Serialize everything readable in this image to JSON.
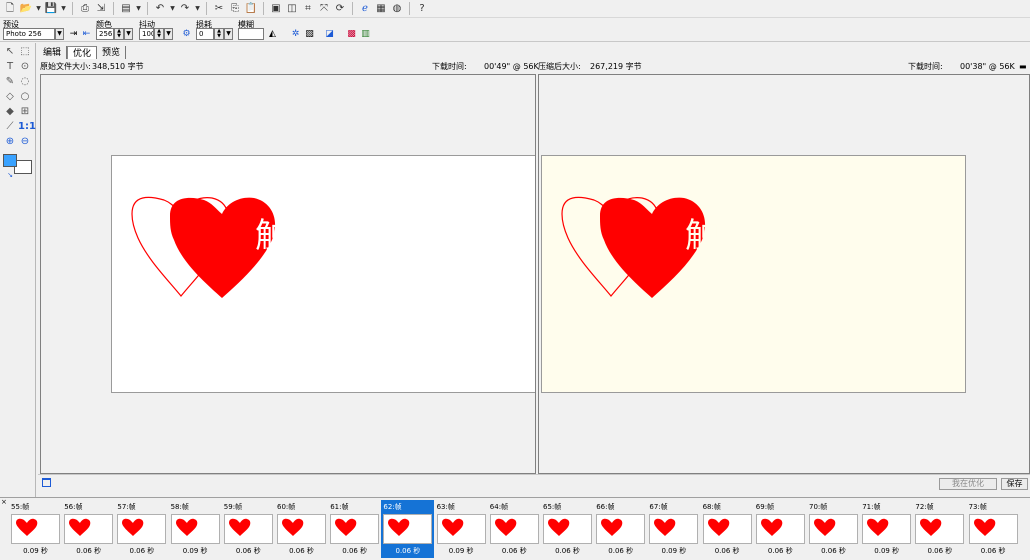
{
  "preset": {
    "label": "预设",
    "value": "Photo 256"
  },
  "colors": {
    "label": "颜色",
    "value": "256"
  },
  "dither": {
    "label": "抖动",
    "value": "100"
  },
  "loss": {
    "label": "损耗",
    "value": "0"
  },
  "blur": {
    "label": "模糊",
    "value": ""
  },
  "tabs": [
    {
      "label": "编辑"
    },
    {
      "label": "优化"
    },
    {
      "label": "预览"
    }
  ],
  "left_info": {
    "size_label": "原始文件大小:",
    "size_value": "348,510 字节",
    "dl_label": "下载时间:",
    "dl_value": "00'49\" @ 56K"
  },
  "right_info": {
    "size_label": "压缩后大小:",
    "size_value": "267,219 字节",
    "dl_label": "下载时间:",
    "dl_value": "00'38\" @ 56K"
  },
  "canvas_char": "触",
  "buttons": {
    "optimizing": "我在优化",
    "save": "保存"
  },
  "frames": [
    {
      "label": "55:帧",
      "delay": "0.09 秒"
    },
    {
      "label": "56:帧",
      "delay": "0.06 秒"
    },
    {
      "label": "57:帧",
      "delay": "0.06 秒"
    },
    {
      "label": "58:帧",
      "delay": "0.09 秒"
    },
    {
      "label": "59:帧",
      "delay": "0.06 秒"
    },
    {
      "label": "60:帧",
      "delay": "0.06 秒"
    },
    {
      "label": "61:帧",
      "delay": "0.06 秒"
    },
    {
      "label": "62:帧",
      "delay": "0.06 秒"
    },
    {
      "label": "63:帧",
      "delay": "0.09 秒"
    },
    {
      "label": "64:帧",
      "delay": "0.06 秒"
    },
    {
      "label": "65:帧",
      "delay": "0.06 秒"
    },
    {
      "label": "66:帧",
      "delay": "0.06 秒"
    },
    {
      "label": "67:帧",
      "delay": "0.09 秒"
    },
    {
      "label": "68:帧",
      "delay": "0.06 秒"
    },
    {
      "label": "69:帧",
      "delay": "0.06 秒"
    },
    {
      "label": "70:帧",
      "delay": "0.06 秒"
    },
    {
      "label": "71:帧",
      "delay": "0.09 秒"
    },
    {
      "label": "72:帧",
      "delay": "0.06 秒"
    },
    {
      "label": "73:帧",
      "delay": "0.06 秒"
    }
  ],
  "selected_frame": "62:帧",
  "colors_theme": {
    "heart": "#ff0000",
    "selection": "#1573d6",
    "compressed_bg": "#fffded",
    "swatch": "#39a2ff"
  }
}
